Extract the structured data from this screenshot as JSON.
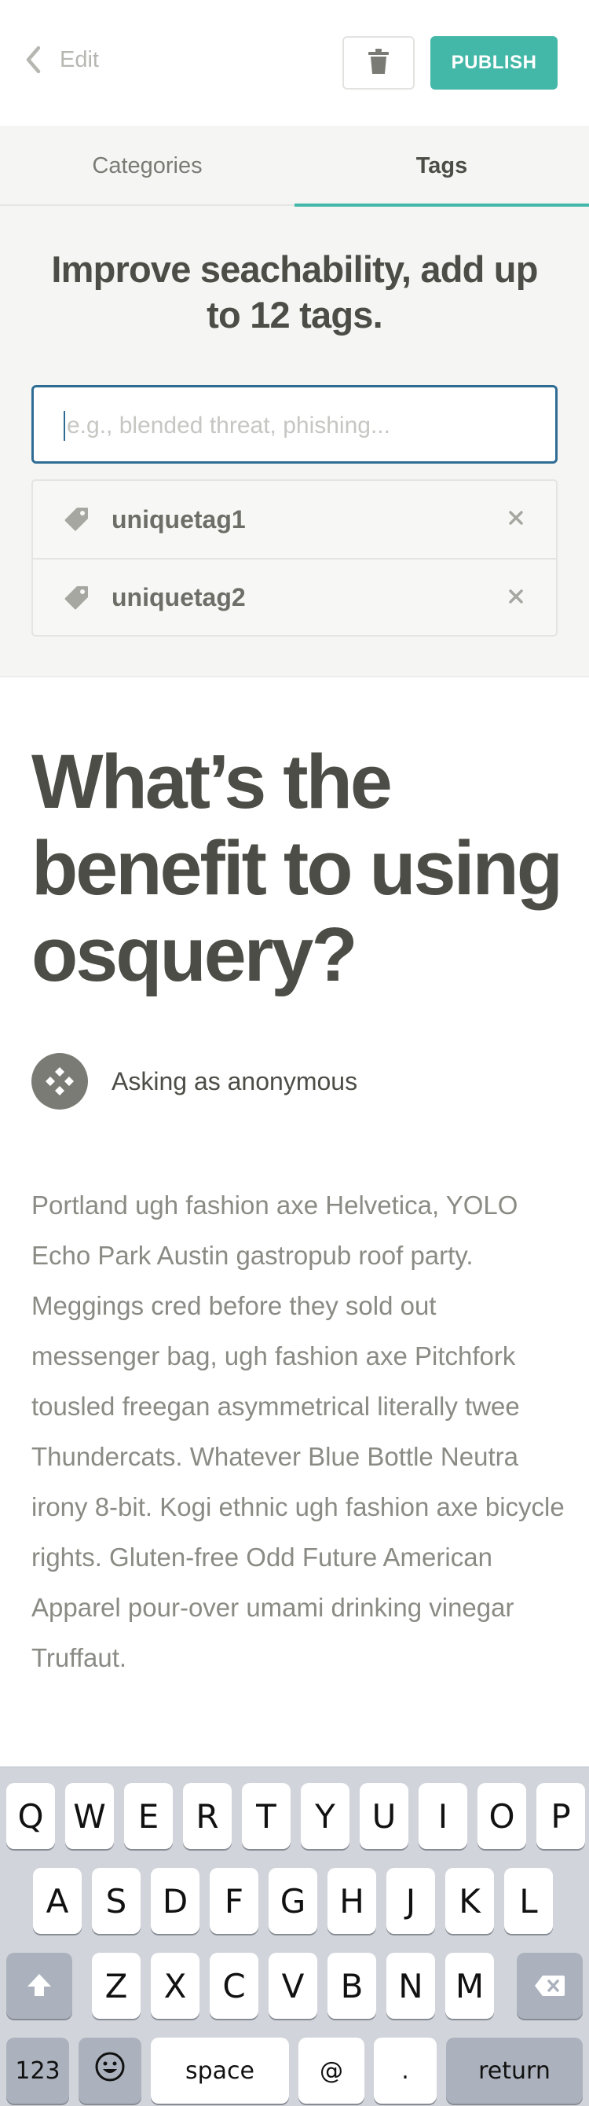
{
  "header": {
    "back_label": "Edit",
    "publish_label": "PUBLISH"
  },
  "tabs": [
    {
      "label": "Categories",
      "active": false
    },
    {
      "label": "Tags",
      "active": true
    }
  ],
  "tags_panel": {
    "heading": "Improve seachability, add up to 12 tags.",
    "input": {
      "value": "",
      "placeholder": "e.g., blended threat, phishing..."
    },
    "tags": [
      {
        "label": "uniquetag1"
      },
      {
        "label": "uniquetag2"
      }
    ]
  },
  "question": {
    "title": "What’s the benefit to using osquery?",
    "asker": "Asking as anonymous",
    "body": "Portland ugh fashion axe Helvetica, YOLO Echo Park Austin gastropub roof party. Meggings cred before they sold out messenger bag, ugh fashion axe Pitchfork tousled freegan asymmetrical literally twee Thundercats. Whatever Blue Bottle Neutra irony 8-bit. Kogi ethnic ugh fashion axe bicycle rights. Gluten-free Odd Future American Apparel pour-over umami drinking vinegar Truffaut."
  },
  "colors": {
    "accent": "#44b8a8",
    "input_border": "#2f6c94",
    "text": "#4d4d47",
    "keyboard_bg": "#d1d5db"
  },
  "keyboard": {
    "row1": [
      "Q",
      "W",
      "E",
      "R",
      "T",
      "Y",
      "U",
      "I",
      "O",
      "P"
    ],
    "row2": [
      "A",
      "S",
      "D",
      "F",
      "G",
      "H",
      "J",
      "K",
      "L"
    ],
    "row3": [
      "Z",
      "X",
      "C",
      "V",
      "B",
      "N",
      "M"
    ],
    "bottom": {
      "numbers": "123",
      "emoji": "😀",
      "space": "space",
      "at": "@",
      "dot": ".",
      "return": "return"
    }
  }
}
